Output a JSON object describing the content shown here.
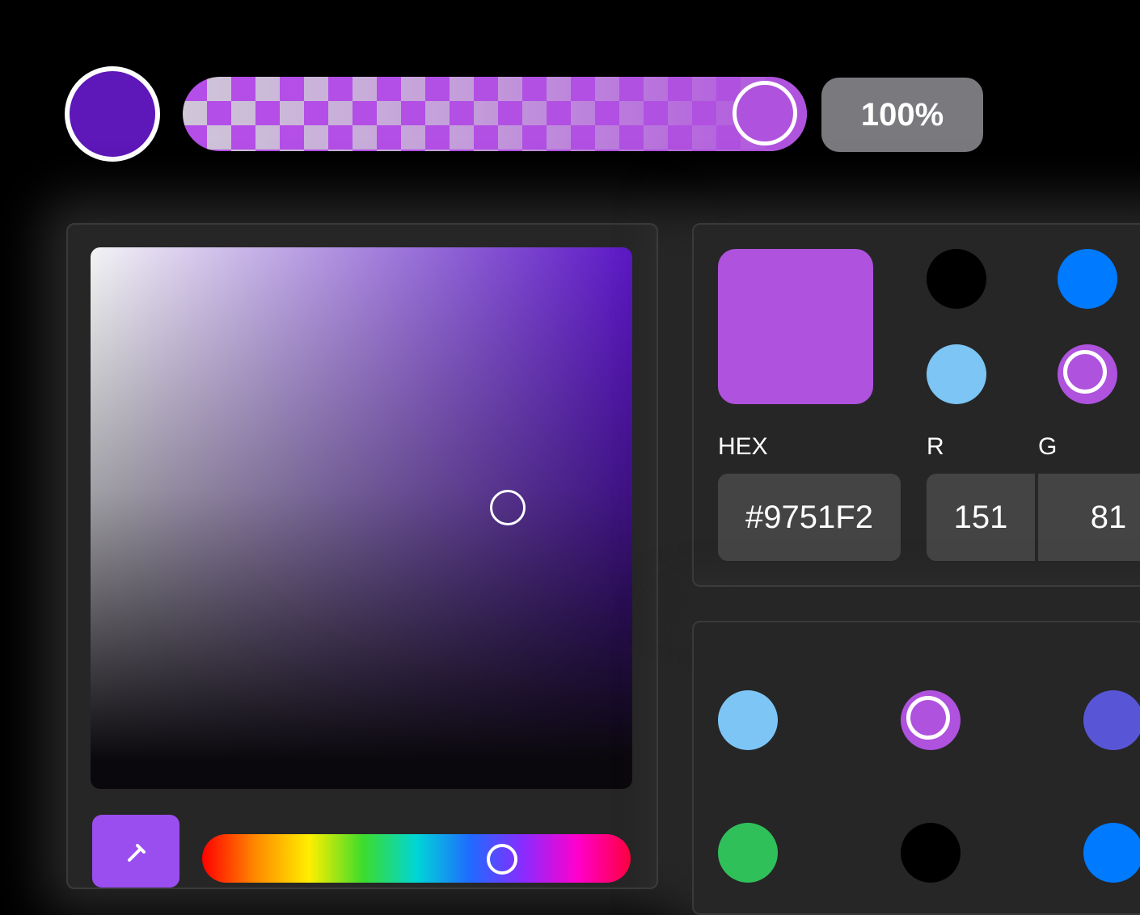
{
  "colors": {
    "current": "#5e17b8",
    "selected": "#af52de",
    "saturation_base": "#5c17c6",
    "eyedropper_bg": "#9a4ef0"
  },
  "opacity": {
    "value_label": "100%",
    "level": 1.0
  },
  "picker": {
    "cursor": {
      "saturation": 0.77,
      "brightness": 0.52
    },
    "hue": 0.7,
    "eyedropper_icon": "eyedropper-icon"
  },
  "info": {
    "hex_label": "HEX",
    "hex_value": "#9751F2",
    "r_label": "R",
    "r_value": "151",
    "g_label": "G",
    "g_value": "81",
    "swatches": [
      "#000000",
      "#007aff",
      "#7cc5f5",
      "#af52de"
    ]
  },
  "presets": {
    "swatches": [
      "#7cc5f5",
      "#af52de",
      "#5856d6",
      "#30c05a",
      "#000000",
      "#007aff"
    ]
  }
}
